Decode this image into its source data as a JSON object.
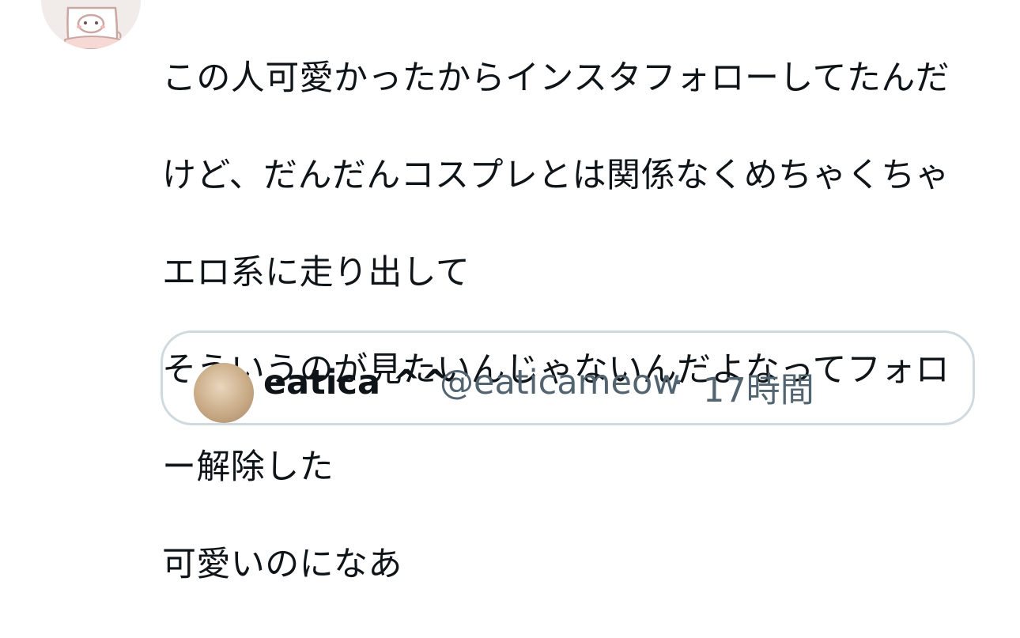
{
  "author": {
    "avatar_icon": "character-avatar-icon"
  },
  "tweet": {
    "lines": [
      "この人可愛かったからインスタフォローしてたんだ",
      "けど、だんだんコスプレとは関係なくめちゃくちゃ",
      "エロ系に走り出して",
      "そういうのが見たいんじゃないんだよなってフォロ",
      "ー解除した",
      "可愛いのになあ"
    ]
  },
  "quote": {
    "name": "eatica ^^",
    "handle": "@eaticameow",
    "separator": "·",
    "time": "17時間"
  },
  "colors": {
    "text": "#0f1419",
    "secondary": "#536471",
    "border": "#cfd9de",
    "avatar_bg": "#f1ecea"
  }
}
